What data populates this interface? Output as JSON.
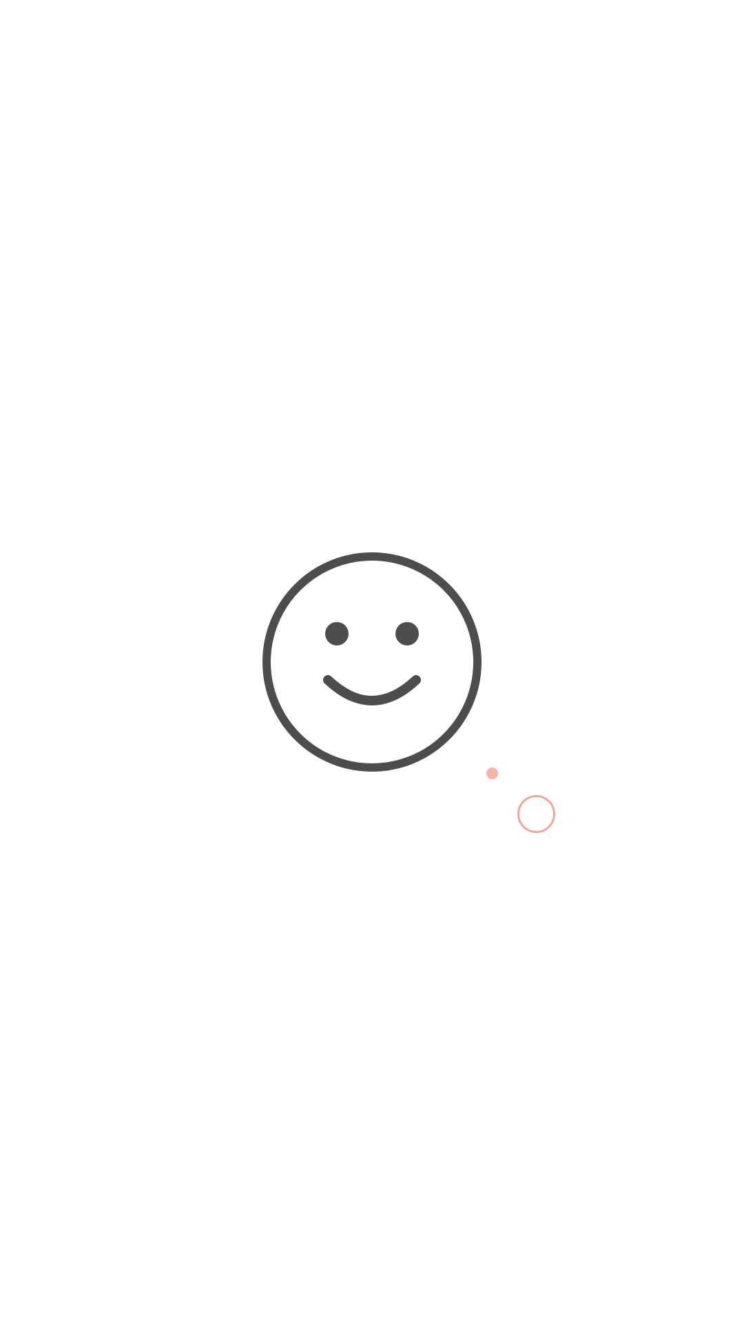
{
  "screen": {
    "background_color": "#ffffff"
  },
  "illustration": {
    "icon": "smiley-face-icon",
    "stroke_color": "#4d4d4d",
    "fill_color": "#ffffff"
  },
  "touch_indicator": {
    "dot_icon": "touch-point-dot",
    "ring_icon": "touch-ripple-ring",
    "color": "#f7b3a8",
    "ring_color": "#f3a59a"
  }
}
